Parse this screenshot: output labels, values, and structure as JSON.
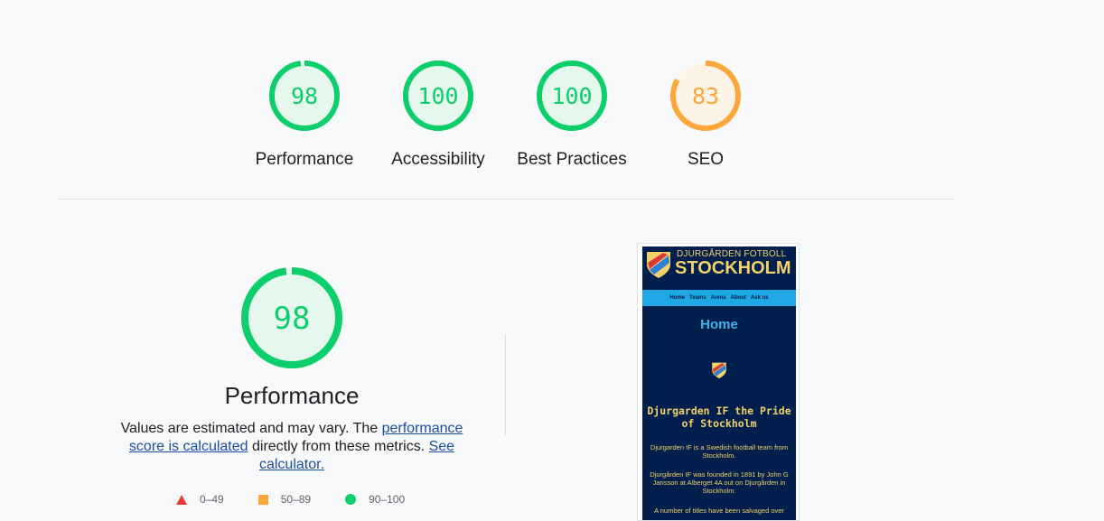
{
  "scores": [
    {
      "value": "98",
      "label": "Performance",
      "color": "#0cce6b",
      "bg": "#e6f8ee",
      "text_color": "#0cce6b",
      "fraction": 0.98
    },
    {
      "value": "100",
      "label": "Accessibility",
      "color": "#0cce6b",
      "bg": "#e6f8ee",
      "text_color": "#0cce6b",
      "fraction": 1.0
    },
    {
      "value": "100",
      "label": "Best Practices",
      "color": "#0cce6b",
      "bg": "#e6f8ee",
      "text_color": "#0cce6b",
      "fraction": 1.0
    },
    {
      "value": "83",
      "label": "SEO",
      "color": "#fba83a",
      "bg": "#fdf3e7",
      "text_color": "#fba83a",
      "fraction": 0.83
    }
  ],
  "performance": {
    "score": "98",
    "fraction": 0.98,
    "title": "Performance",
    "desc_prefix": "Values are estimated and may vary. The ",
    "link1": "performance score is calculated",
    "desc_middle": " directly from these metrics. ",
    "link2": "See calculator."
  },
  "legend": [
    {
      "shape": "triangle",
      "label": "0–49",
      "color": "#e53935"
    },
    {
      "shape": "square",
      "label": "50–89",
      "color": "#fba83a"
    },
    {
      "shape": "circle",
      "label": "90–100",
      "color": "#0cce6b"
    }
  ],
  "site": {
    "subtitle": "DJURGÅRDEN FOTBOLL",
    "name": "STOCKHOLM",
    "nav": [
      "Home",
      "Teams",
      "Arena",
      "About",
      "Ask us"
    ],
    "page_heading": "Home",
    "headline": "Djurgarden IF the Pride of Stockholm",
    "para1": "Djurgarden IF is a Swedish football team from Stockholm.",
    "para2": "Djurgården IF was founded in 1891 by John G Jansson at Alberget 4A out on Djurgården in Stockholm.",
    "para3": "A number of titles have been salvaged over"
  }
}
